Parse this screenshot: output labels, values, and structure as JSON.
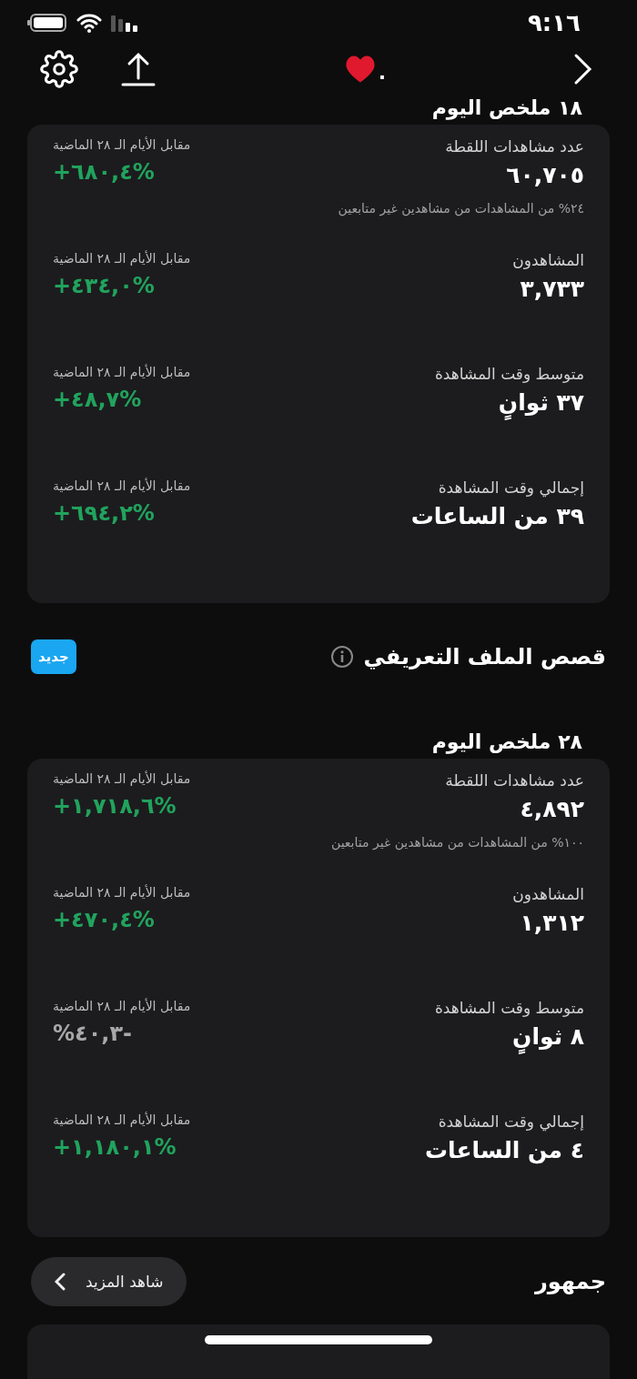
{
  "status_bar": {
    "time": "٩:١٦"
  },
  "header": {
    "title_dot": "."
  },
  "summaries": [
    {
      "title": "١٨ ملخص اليوم",
      "metrics": [
        {
          "label": "عدد مشاهدات اللقطة",
          "value": "٦٠,٧٠٥",
          "note": "٢٤% من المشاهدات من مشاهدين غير متابعين",
          "compare": "مقابل الأيام الـ ٢٨ الماضية",
          "change": "+٦٨٠,٤%",
          "positive": true
        },
        {
          "label": "المشاهدون",
          "value": "٣,٧٣٣",
          "compare": "مقابل الأيام الـ ٢٨ الماضية",
          "change": "+٤٣٤,٠%",
          "positive": true
        },
        {
          "label": "متوسط وقت المشاهدة",
          "value": "٣٧ ثوانٍ",
          "compare": "مقابل الأيام الـ ٢٨ الماضية",
          "change": "+٤٨,٧%",
          "positive": true
        },
        {
          "label": "إجمالي وقت المشاهدة",
          "value": "٣٩ من الساعات",
          "compare": "مقابل الأيام الـ ٢٨ الماضية",
          "change": "+٦٩٤,٢%",
          "positive": true
        }
      ]
    },
    {
      "section": {
        "title": "قصص الملف التعريفي",
        "badge": "جديد"
      },
      "title": "٢٨ ملخص اليوم",
      "metrics": [
        {
          "label": "عدد مشاهدات اللقطة",
          "value": "٤,٨٩٢",
          "note": "١٠٠% من المشاهدات من مشاهدين غير متابعين",
          "compare": "مقابل الأيام الـ ٢٨ الماضية",
          "change": "+١,٧١٨,٦%",
          "positive": true
        },
        {
          "label": "المشاهدون",
          "value": "١,٣١٢",
          "compare": "مقابل الأيام الـ ٢٨ الماضية",
          "change": "+٤٧٠,٤%",
          "positive": true
        },
        {
          "label": "متوسط وقت المشاهدة",
          "value": "٨ ثوانٍ",
          "compare": "مقابل الأيام الـ ٢٨ الماضية",
          "change": "%٤٠,٣-",
          "positive": false
        },
        {
          "label": "إجمالي وقت المشاهدة",
          "value": "٤ من الساعات",
          "compare": "مقابل الأيام الـ ٢٨ الماضية",
          "change": "+١,١٨٠,١%",
          "positive": true
        }
      ]
    }
  ],
  "audience": {
    "title": "جمهور",
    "more_button": "شاهد المزيد"
  }
}
